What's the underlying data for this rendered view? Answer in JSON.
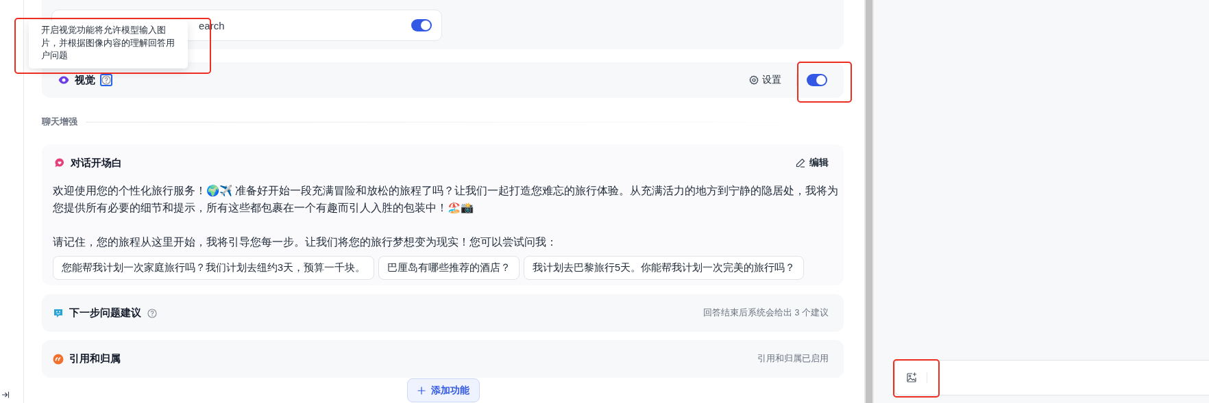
{
  "top_card": {
    "item_label": "earch",
    "toggle_on": true
  },
  "tooltip": {
    "text": "开启视觉功能将允许模型输入图片，并根据图像内容的理解回答用户问题"
  },
  "vision": {
    "title": "视觉",
    "settings_label": "设置",
    "on": true
  },
  "section_label": "聊天增强",
  "opener": {
    "title": "对话开场白",
    "edit_label": "编辑",
    "paragraphs": [
      "欢迎使用您的个性化旅行服务！🌍✈️ 准备好开始一段充满冒险和放松的旅程了吗？让我们一起打造您难忘的旅行体验。从充满活力的地方到宁静的隐居处，我将为您提供所有必要的细节和提示，所有这些都包裹在一个有趣而引人入胜的包装中！🏖️📸",
      "请记住，您的旅程从这里开始，我将引导您每一步。让我们将您的旅行梦想变为现实！您可以尝试问我："
    ],
    "questions": [
      "您能帮我计划一次家庭旅行吗？我们计划去纽约3天，预算一千块。",
      "巴厘岛有哪些推荐的酒店？",
      "我计划去巴黎旅行5天。你能帮我计划一次完美的旅行吗？"
    ]
  },
  "features": [
    {
      "kind": "suggestions",
      "title": "下一步问题建议",
      "status": "回答结束后系统会给出 3 个建议"
    },
    {
      "kind": "citation",
      "title": "引用和归属",
      "status": "引用和归属已启用"
    }
  ],
  "add_button": "添加功能"
}
